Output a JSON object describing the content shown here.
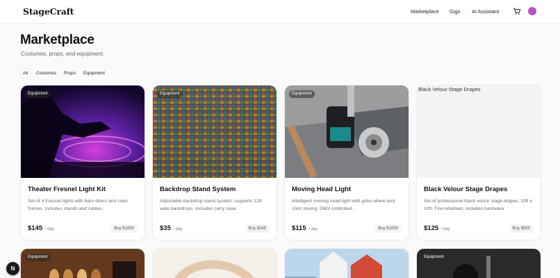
{
  "brand": {
    "logo": "StageCraft"
  },
  "nav": {
    "links": [
      "Marketplace",
      "Gigs",
      "AI Assistant"
    ],
    "cart_icon": "cart-icon",
    "avatar_color": "#c94fcf"
  },
  "header": {
    "title": "Marketplace",
    "subtitle": "Costumes, props, and equipment."
  },
  "filters": {
    "items": [
      "All",
      "Costumes",
      "Props",
      "Equipment"
    ],
    "active": "All"
  },
  "products": [
    {
      "badge": "Equipment",
      "title": "Theater Fresnel Light Kit",
      "description": "Set of 4 Fresnel lights with barn doors and color frames. Includes stands and cables.",
      "price": "$145",
      "per": "/ day",
      "buy": "Buy $1850"
    },
    {
      "badge": "Equipment",
      "title": "Backdrop Stand System",
      "description": "Adjustable backdrop stand system, supports 12ft wide backdrops. Includes carry case.",
      "price": "$35",
      "per": "/ day",
      "buy": "Buy $245"
    },
    {
      "badge": "Equipment",
      "title": "Moving Head Light",
      "description": "Intelligent moving head light with gobo wheel and color mixing. DMX controlled.",
      "price": "$115",
      "per": "/ day",
      "buy": "Buy $1650"
    },
    {
      "badge": "",
      "image_alt": "Black Velour Stage Drapes",
      "title": "Black Velour Stage Drapes",
      "description": "Set of professional black velour stage drapes, 20ft x 10ft. Fire-retardant, includes hardware.",
      "price": "$125",
      "per": "/ day",
      "buy": "Buy $950"
    }
  ],
  "row2": {
    "badges": [
      "Equipment",
      "Equipment"
    ]
  },
  "fab": {
    "label": "N"
  }
}
